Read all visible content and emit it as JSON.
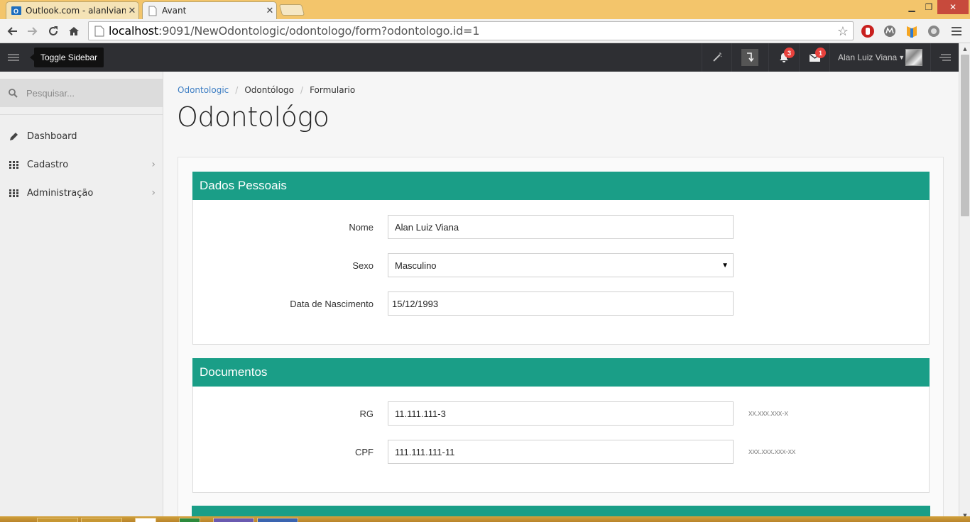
{
  "browser": {
    "tabs": [
      {
        "title": "Outlook.com - alanlvianaf",
        "active": false
      },
      {
        "title": "Avant",
        "active": true
      }
    ],
    "url_host": "localhost",
    "url_rest": ":9091/NewOdontologic/odontologo/form?odontologo.id=1",
    "icons": [
      "back-icon",
      "forward-icon",
      "reload-icon",
      "home-icon",
      "star-icon",
      "adblock-icon",
      "motorola-icon",
      "extension-icon",
      "settings-icon",
      "menu-icon"
    ]
  },
  "header": {
    "tooltip": "Toggle Sidebar",
    "notifications_count": "3",
    "messages_count": "1",
    "user_name": "Alan Luiz Viana"
  },
  "sidebar": {
    "search_placeholder": "Pesquisar...",
    "items": [
      {
        "label": "Dashboard",
        "icon": "pencil-icon"
      },
      {
        "label": "Cadastro",
        "icon": "grid-icon"
      },
      {
        "label": "Administração",
        "icon": "grid-icon"
      }
    ]
  },
  "main": {
    "breadcrumb": [
      "Odontologic",
      "Odontólogo",
      "Formulario"
    ],
    "title": "Odontológo",
    "sections": [
      {
        "title": "Dados Pessoais",
        "fields": [
          {
            "label": "Nome",
            "value": "Alan Luiz Viana"
          },
          {
            "label": "Sexo",
            "value": "Masculino"
          },
          {
            "label": "Data de Nascimento",
            "value": "15/12/1993"
          }
        ]
      },
      {
        "title": "Documentos",
        "fields": [
          {
            "label": "RG",
            "value": "11.111.111-3",
            "hint": "xx.xxx.xxx-x"
          },
          {
            "label": "CPF",
            "value": "111.111.111-11",
            "hint": "xxx.xxx.xxx-xx"
          }
        ]
      }
    ]
  },
  "colors": {
    "section_header": "#1a9e87",
    "app_header": "#2e2f33",
    "badge": "#e8413c",
    "link": "#3f7fc4"
  }
}
